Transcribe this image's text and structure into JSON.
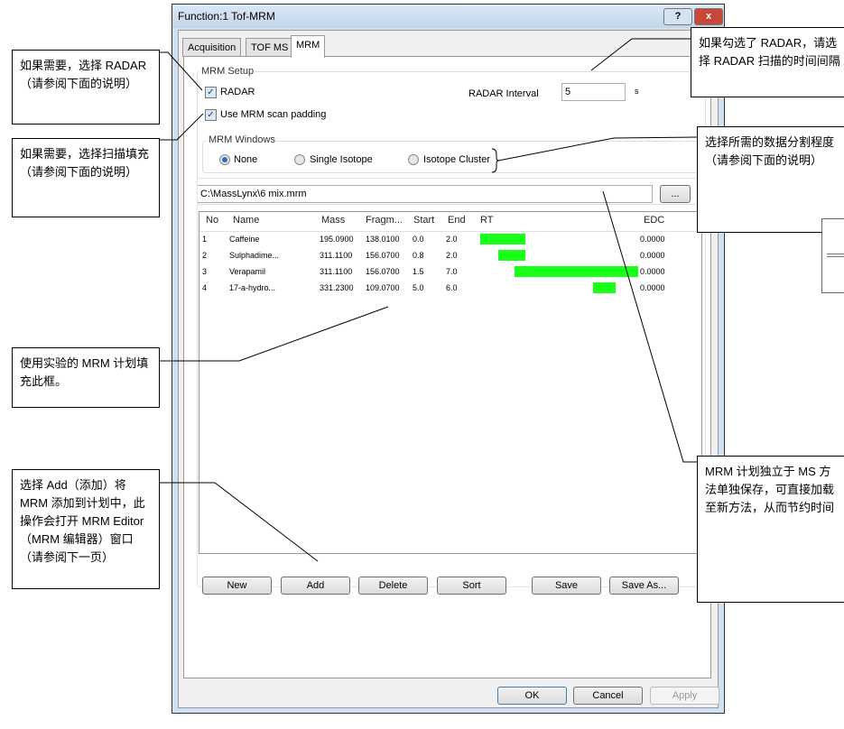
{
  "window": {
    "title": "Function:1 Tof-MRM",
    "help_label": "?",
    "close_label": "x"
  },
  "tabs": [
    "Acquisition",
    "TOF MS",
    "MRM"
  ],
  "mrm_setup": {
    "label": "MRM Setup",
    "radar_label": "RADAR",
    "radar_checked": true,
    "interval_label": "RADAR Interval",
    "interval_value": "5",
    "interval_unit": "s",
    "padding_label": "Use MRM scan padding",
    "padding_checked": true
  },
  "mrm_windows": {
    "label": "MRM Windows",
    "options": [
      "None",
      "Single Isotope",
      "Isotope Cluster"
    ],
    "selected": "None"
  },
  "file": {
    "path": "C:\\MassLynx\\6 mix.mrm",
    "browse_label": "..."
  },
  "table": {
    "columns": [
      "No",
      "Name",
      "Mass",
      "Fragm...",
      "Start",
      "End",
      "RT",
      "EDC"
    ],
    "rows": [
      {
        "no": "1",
        "name": "Caffeine",
        "mass": "195.0900",
        "frag": "138.0100",
        "start": "0.0",
        "end": "2.0",
        "edc": "0.0000"
      },
      {
        "no": "2",
        "name": "Sulphadime...",
        "mass": "311.1100",
        "frag": "156.0700",
        "start": "0.8",
        "end": "2.0",
        "edc": "0.0000"
      },
      {
        "no": "3",
        "name": "Verapamil",
        "mass": "311.1100",
        "frag": "156.0700",
        "start": "1.5",
        "end": "7.0",
        "edc": "0.0000"
      },
      {
        "no": "4",
        "name": "17-a-hydro...",
        "mass": "331.2300",
        "frag": "109.0700",
        "start": "5.0",
        "end": "6.0",
        "edc": "0.0000"
      }
    ],
    "rt_bar_color": "#18ff18"
  },
  "list_buttons": [
    "New",
    "Add",
    "Delete",
    "Sort",
    "Save",
    "Save As..."
  ],
  "dialog_buttons": {
    "ok": "OK",
    "cancel": "Cancel",
    "apply": "Apply"
  },
  "callouts": [
    "如果需要，选择 RADAR（请参阅下面的说明）",
    "如果需要，选择扫描填充（请参阅下面的说明）",
    "使用实验的 MRM 计划填充此框。",
    "选择 Add（添加）将 MRM 添加到计划中，此操作会打开 MRM Editor（MRM 编辑器）窗口（请参阅下一页）",
    "如果勾选了 RADAR，请选择 RADAR 扫描的时间间隔",
    "选择所需的数据分割程度（请参阅下面的说明）",
    "MRM 计划独立于 MS 方法单独保存，可直接加载至新方法，从而节约时间"
  ]
}
